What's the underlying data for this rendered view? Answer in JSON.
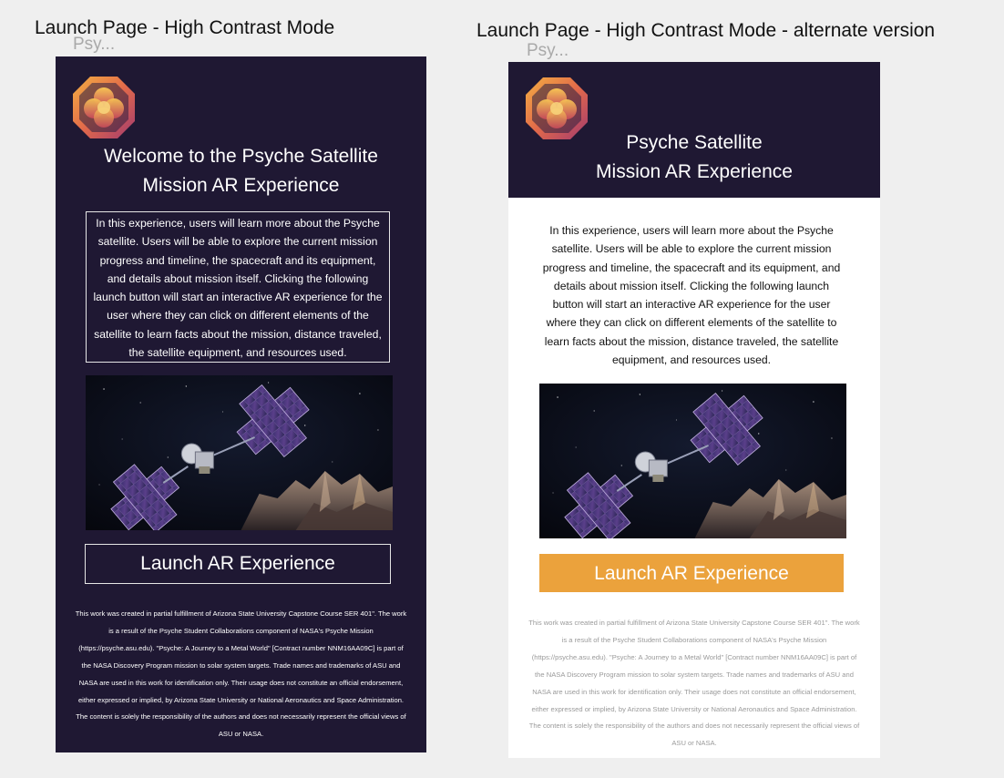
{
  "colors": {
    "canvas": "#efefef",
    "dark_purple": "#1f1833",
    "white": "#ffffff",
    "orange_button": "#eba23c",
    "muted_footer_text": "#9a9a9a"
  },
  "frame1": {
    "title": "Launch Page - High Contrast Mode",
    "sub_label": "Psy...",
    "logo_icon": "psyche-logo-icon",
    "heading_line1": "Welcome to the Psyche Satellite",
    "heading_line2": "Mission AR Experience",
    "description": "In this experience, users will learn more about the Psyche satellite. Users will be able to explore the current mission progress and timeline, the spacecraft and its equipment, and details about mission itself. Clicking the following launch button will start an interactive AR experience for the user where they can click on different elements of the satellite to learn facts about the mission, distance traveled, the satellite equipment, and resources used.",
    "launch_button": "Launch AR Experience",
    "footer": "This work was created in partial fulfillment of Arizona State University Capstone Course SER 401\". The work is a result of the Psyche Student Collaborations component of NASA's Psyche Mission (https://psyche.asu.edu). \"Psyche: A Journey to a Metal World\" [Contract number NNM16AA09C] is part of the NASA Discovery Program mission to solar system targets. Trade names and trademarks of ASU and NASA are used in this work for identification only. Their usage does not constitute an official endorsement, either expressed or implied, by Arizona State University or National Aeronautics and Space Administration. The content is solely the responsibility of the authors and does not necessarily represent the official views of ASU or NASA."
  },
  "frame2": {
    "title": "Launch Page - High Contrast Mode - alternate version",
    "sub_label": "Psy...",
    "logo_icon": "psyche-logo-icon",
    "heading_line1": "Psyche Satellite",
    "heading_line2": "Mission AR Experience",
    "description": "In this experience, users will learn more about the Psyche satellite. Users will be able to explore the current mission progress and timeline, the spacecraft and its equipment, and details about mission itself. Clicking the following launch button will start an interactive AR experience for the user where they can click on different elements of the satellite to learn facts about the mission, distance traveled, the satellite equipment, and resources used.",
    "launch_button": "Launch AR Experience",
    "footer": "This work was created in partial fulfillment of Arizona State University Capstone Course SER 401\". The work is a result of the Psyche Student Collaborations component of NASA's Psyche Mission (https://psyche.asu.edu). \"Psyche: A Journey to a Metal World\" [Contract number NNM16AA09C] is part of the NASA Discovery Program mission to solar system targets. Trade names and trademarks of ASU and NASA are used in this work for identification only. Their usage does not constitute an official endorsement, either expressed or implied, by Arizona State University or National Aeronautics and Space Administration. The content is solely the responsibility of the authors and does not necessarily represent the official views of ASU or NASA."
  }
}
